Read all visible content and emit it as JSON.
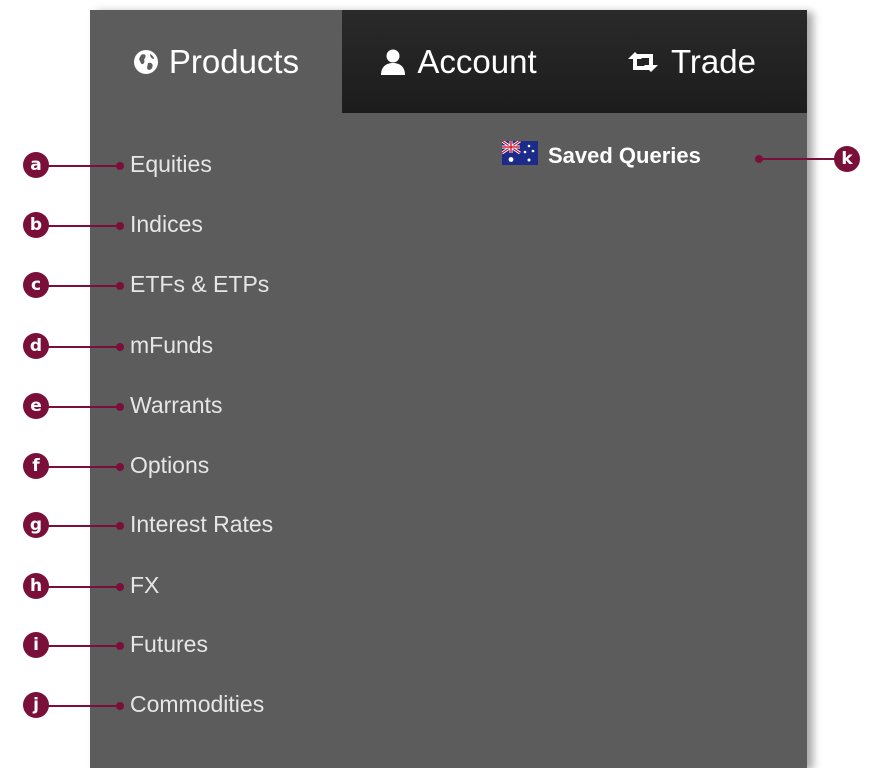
{
  "tabs": {
    "products": "Products",
    "account": "Account",
    "trade": "Trade"
  },
  "menu": {
    "items": [
      {
        "label": "Equities",
        "marker": "a"
      },
      {
        "label": "Indices",
        "marker": "b"
      },
      {
        "label": "ETFs & ETPs",
        "marker": "c"
      },
      {
        "label": "mFunds",
        "marker": "d"
      },
      {
        "label": "Warrants",
        "marker": "e"
      },
      {
        "label": "Options",
        "marker": "f"
      },
      {
        "label": "Interest Rates",
        "marker": "g"
      },
      {
        "label": "FX",
        "marker": "h"
      },
      {
        "label": "Futures",
        "marker": "i"
      },
      {
        "label": "Commodities",
        "marker": "j"
      }
    ]
  },
  "saved_queries": {
    "label": "Saved Queries",
    "marker": "k",
    "flag_icon": "australia-flag-icon"
  },
  "icons": {
    "products": "globe-icon",
    "account": "user-icon",
    "trade": "retweet-icon"
  },
  "colors": {
    "panel_bg": "#5c5c5c",
    "active_tabs_bg": "#222222",
    "annotation": "#7a1039",
    "menu_text": "#e6e6e6"
  }
}
